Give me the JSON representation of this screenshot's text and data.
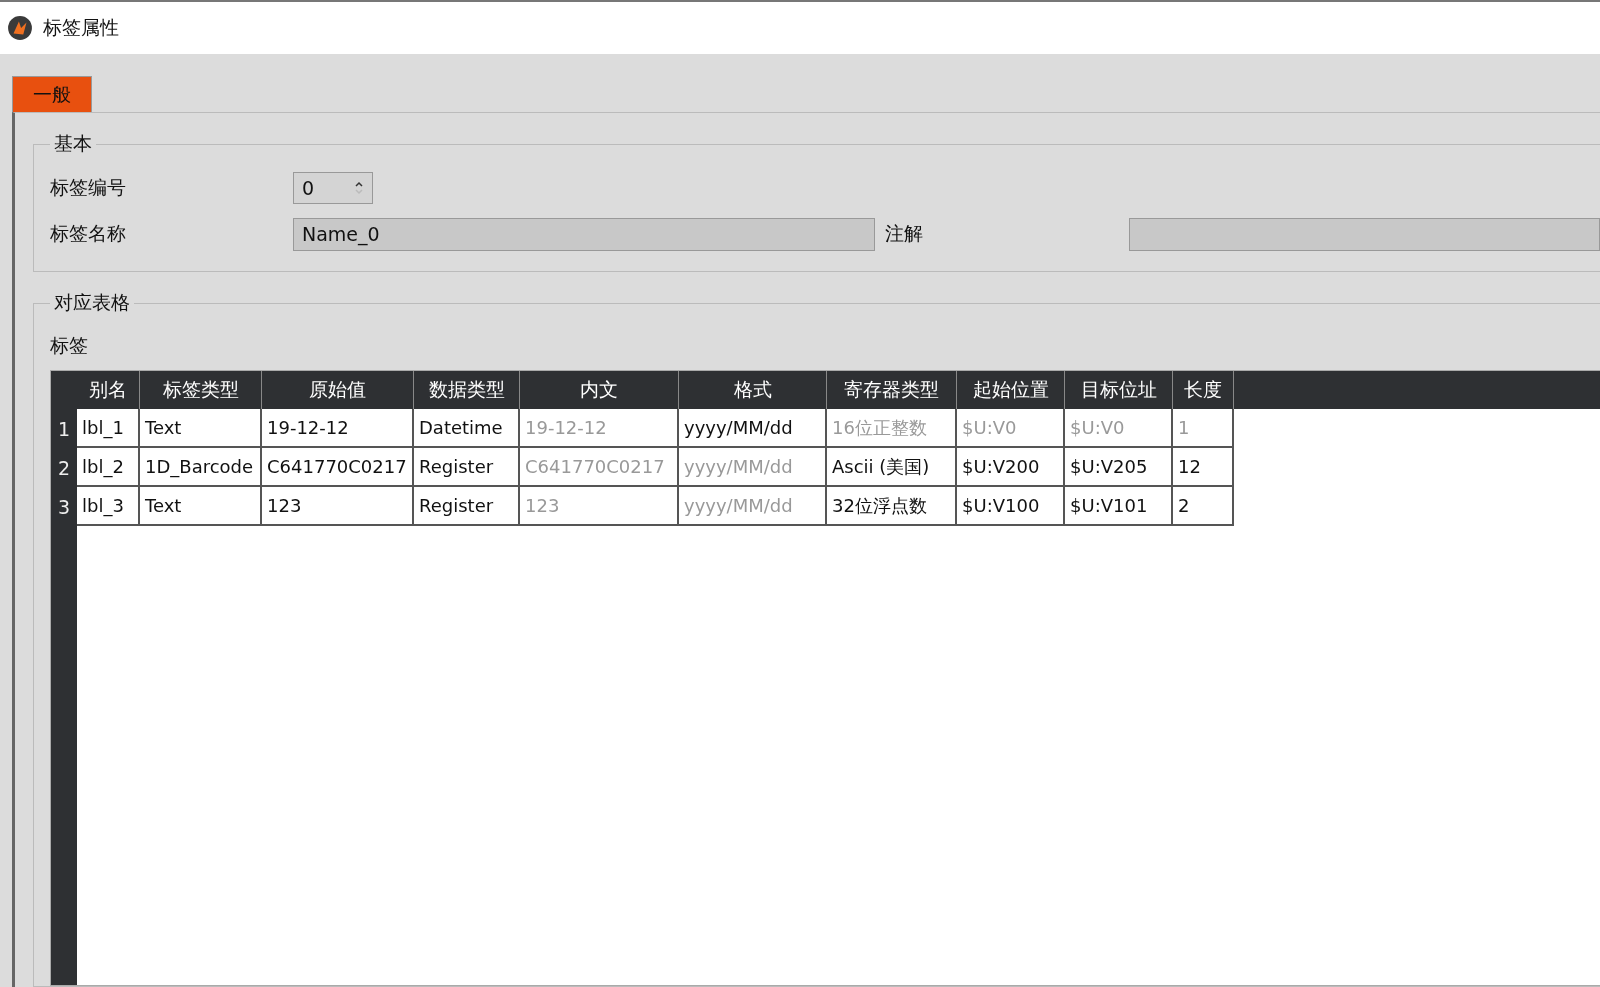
{
  "window": {
    "title": "标签属性"
  },
  "tabs": [
    {
      "label": "一般",
      "selected": true
    }
  ],
  "basic": {
    "title": "基本",
    "tag_number_label": "标签编号",
    "tag_number": "0",
    "tag_name_label": "标签名称",
    "tag_name": "Name_0",
    "comment_label": "注解"
  },
  "mapping": {
    "title": "对应表格",
    "subtitle": "标签",
    "columns": [
      "别名",
      "标签类型",
      "原始值",
      "数据类型",
      "内文",
      "格式",
      "寄存器类型",
      "起始位置",
      "目标位址",
      "长度"
    ],
    "rows": [
      {
        "number": "1",
        "cells": [
          {
            "text": "lbl_1",
            "disabled": false
          },
          {
            "text": "Text",
            "disabled": false
          },
          {
            "text": "19-12-12",
            "disabled": false
          },
          {
            "text": "Datetime",
            "disabled": false
          },
          {
            "text": "19-12-12",
            "disabled": true
          },
          {
            "text": "yyyy/MM/dd",
            "disabled": false
          },
          {
            "text": "16位正整数",
            "disabled": true
          },
          {
            "text": "$U:V0",
            "disabled": true
          },
          {
            "text": "$U:V0",
            "disabled": true
          },
          {
            "text": "1",
            "disabled": true
          }
        ]
      },
      {
        "number": "2",
        "cells": [
          {
            "text": "lbl_2",
            "disabled": false
          },
          {
            "text": "1D_Barcode",
            "disabled": false
          },
          {
            "text": "C641770C0217",
            "disabled": false
          },
          {
            "text": "Register",
            "disabled": false
          },
          {
            "text": "C641770C0217",
            "disabled": true
          },
          {
            "text": "yyyy/MM/dd",
            "disabled": true
          },
          {
            "text": "Ascii (美国)",
            "disabled": false
          },
          {
            "text": "$U:V200",
            "disabled": false
          },
          {
            "text": "$U:V205",
            "disabled": false
          },
          {
            "text": "12",
            "disabled": false
          }
        ]
      },
      {
        "number": "3",
        "cells": [
          {
            "text": "lbl_3",
            "disabled": false
          },
          {
            "text": "Text",
            "disabled": false
          },
          {
            "text": "123",
            "disabled": false
          },
          {
            "text": "Register",
            "disabled": false
          },
          {
            "text": "123",
            "disabled": true
          },
          {
            "text": "yyyy/MM/dd",
            "disabled": true
          },
          {
            "text": "32位浮点数",
            "disabled": false
          },
          {
            "text": "$U:V100",
            "disabled": false
          },
          {
            "text": "$U:V101",
            "disabled": false
          },
          {
            "text": "2",
            "disabled": false
          }
        ]
      }
    ]
  }
}
